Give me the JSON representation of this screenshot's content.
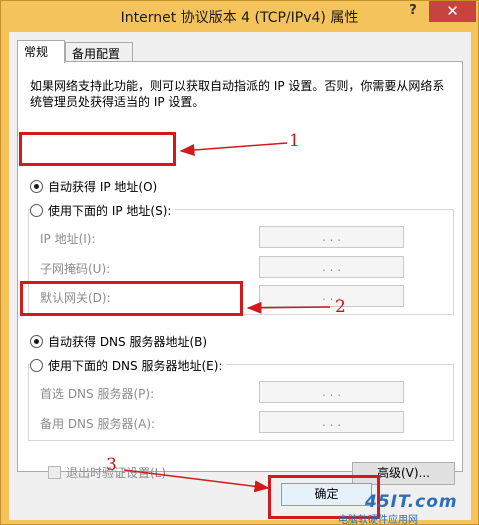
{
  "window": {
    "title": "Internet 协议版本 4 (TCP/IPv4) 属性",
    "help_label": "?",
    "close_label": "✕"
  },
  "tabs": [
    {
      "label": "常规",
      "active": true
    },
    {
      "label": "备用配置",
      "active": false
    }
  ],
  "description": "如果网络支持此功能，则可以获取自动指派的 IP 设置。否则，你需要从网络系统管理员处获得适当的 IP 设置。",
  "ip_section": {
    "auto_label": "自动获得 IP 地址(O)",
    "manual_label": "使用下面的 IP 地址(S):",
    "fields": [
      {
        "label": "IP 地址(I):",
        "value": ".   .   ."
      },
      {
        "label": "子网掩码(U):",
        "value": ".   .   ."
      },
      {
        "label": "默认网关(D):",
        "value": ".   .   ."
      }
    ]
  },
  "dns_section": {
    "auto_label": "自动获得 DNS 服务器地址(B)",
    "manual_label": "使用下面的 DNS 服务器地址(E):",
    "fields": [
      {
        "label": "首选 DNS 服务器(P):",
        "value": ".   .   ."
      },
      {
        "label": "备用 DNS 服务器(A):",
        "value": ".   .   ."
      }
    ]
  },
  "validate_label": "退出时验证设置(L)",
  "advanced_label": "高级(V)...",
  "ok_label": "确定",
  "callouts": [
    "1",
    "2",
    "3"
  ],
  "watermark": {
    "logo": "45IT.com",
    "subtitle": "电脑软硬件应用网"
  },
  "colors": {
    "callout": "#d21a1a",
    "title_bar": "#f5c35c",
    "close_button": "#c7433d"
  }
}
